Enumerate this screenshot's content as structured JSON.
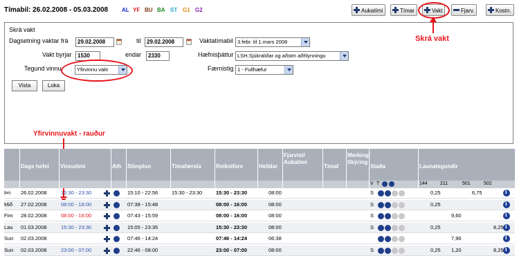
{
  "header": {
    "timabil": "Tímabil: 26.02.2008 - 05.03.2008",
    "codes": [
      {
        "label": "AL",
        "color": "#1b2bd0"
      },
      {
        "label": "YF",
        "color": "#e01414"
      },
      {
        "label": "BU",
        "color": "#7a3a10"
      },
      {
        "label": "BA",
        "color": "#1d8a1d"
      },
      {
        "label": "ST",
        "color": "#27a9c6"
      },
      {
        "label": "G1",
        "color": "#e08a14"
      },
      {
        "label": "G2",
        "color": "#8a1fae"
      }
    ],
    "buttons": {
      "aukatimi": "Aukatími",
      "timar": "Tímar",
      "vakt": "Vakt",
      "fjarv": "Fjarv.",
      "kostn": "Kostn."
    }
  },
  "form": {
    "title": "Skrá vakt",
    "date_from_label": "Dagsetning vaktar frá",
    "date_from": "29.02.2008",
    "til_label": "til",
    "date_to": "29.02.2008",
    "vaktatimabil_label": "Vaktatímabil",
    "vaktatimabil_value": "3.febr. til 1.mars 2008",
    "vakt_byrjar_label": "Vakt byrjar",
    "vakt_byrjar": "1530",
    "endar_label": "endar",
    "endar": "2330",
    "haefnisthattur_label": "Hæfnisþáttur",
    "haefnisthattur_value": "LSH.Sjúkraliðar og aðstm aðhlynningu",
    "tegund_label": "Tegund vinnu",
    "tegund_value": "Yfirvinnu vakt",
    "faernistig_label": "Færnistig",
    "faernistig_value": "1 - Fullhæfur",
    "vista": "Vista",
    "loka": "Loka"
  },
  "annotations": {
    "skra_vakt": "Skrá vakt",
    "yfirvinnuvakt": "Yfirvinnuvakt - rauður"
  },
  "table": {
    "headers": {
      "dags": "Dags hefst",
      "vinnutimi": "Vinnutími",
      "ath": "Ath",
      "stimplun": "Stimplun",
      "timafaersla": "Tímafærsla",
      "reiknifors": "Reiknifors",
      "heildar": "Heildar",
      "fjarvist": "Fjarvist/ Aukatími",
      "timaf": "Tímaf",
      "merking": "Merking/ Skýring",
      "stada": "Staða",
      "launategundir": "Launategundir",
      "stada_v": "V",
      "stada_t": "T",
      "lt_144": "144",
      "lt_211": "211",
      "lt_501": "501",
      "lt_502": "502"
    },
    "rows": [
      {
        "day": "Þri",
        "date": "26.02.2008",
        "vinnutimi": "15:30 - 23:30",
        "vcolor": "blue",
        "stimplun": "15:10 - 22:56",
        "timafaersla": "15:30 - 23:30",
        "reiknifors": "15:30 - 23:30",
        "heildar": "08:00",
        "s": "S",
        "v144": "0,25",
        "v211": "",
        "v501": "6,75",
        "v502": ""
      },
      {
        "day": "Mið",
        "date": "27.02.2008",
        "vinnutimi": "08:00 - 16:00",
        "vcolor": "blue",
        "stimplun": "07:38 - 15:48",
        "timafaersla": "",
        "reiknifors": "08:00 - 16:00",
        "heildar": "08:00",
        "s": "S",
        "v144": "0,25",
        "v211": "",
        "v501": "",
        "v502": ""
      },
      {
        "day": "Fim",
        "date": "28.02.2008",
        "vinnutimi": "08:00 - 16:00",
        "vcolor": "red",
        "stimplun": "07:43 - 15:59",
        "timafaersla": "",
        "reiknifors": "08:00 - 16:00",
        "heildar": "08:00",
        "s": "S",
        "v144": "",
        "v211": "9,60",
        "v501": "",
        "v502": ""
      },
      {
        "day": "Lau",
        "date": "01.03.2008",
        "vinnutimi": "15:30 - 23:30",
        "vcolor": "blue",
        "stimplun": "15:05 - 23:35",
        "timafaersla": "",
        "reiknifors": "15:30 - 23:30",
        "heildar": "08:00",
        "s": "S",
        "v144": "0,25",
        "v211": "",
        "v501": "",
        "v502": "8,25"
      },
      {
        "day": "Sun",
        "date": "02.03.2008",
        "vinnutimi": "",
        "vcolor": "blue",
        "stimplun": "07:46 - 14:24",
        "timafaersla": "",
        "reiknifors": "07:46 - 14:24",
        "heildar": "06:38",
        "s": "",
        "v144": "",
        "v211": "7,96",
        "v501": "",
        "v502": ""
      },
      {
        "day": "Sun",
        "date": "02.03.2008",
        "vinnutimi": "23:00 - 07:00",
        "vcolor": "blue",
        "stimplun": "22:46 - 08:00",
        "timafaersla": "",
        "reiknifors": "23:00 - 07:00",
        "heildar": "08:00",
        "s": "S",
        "v144": "0,25",
        "v211": "1,20",
        "v501": "",
        "v502": "8,25"
      }
    ]
  }
}
